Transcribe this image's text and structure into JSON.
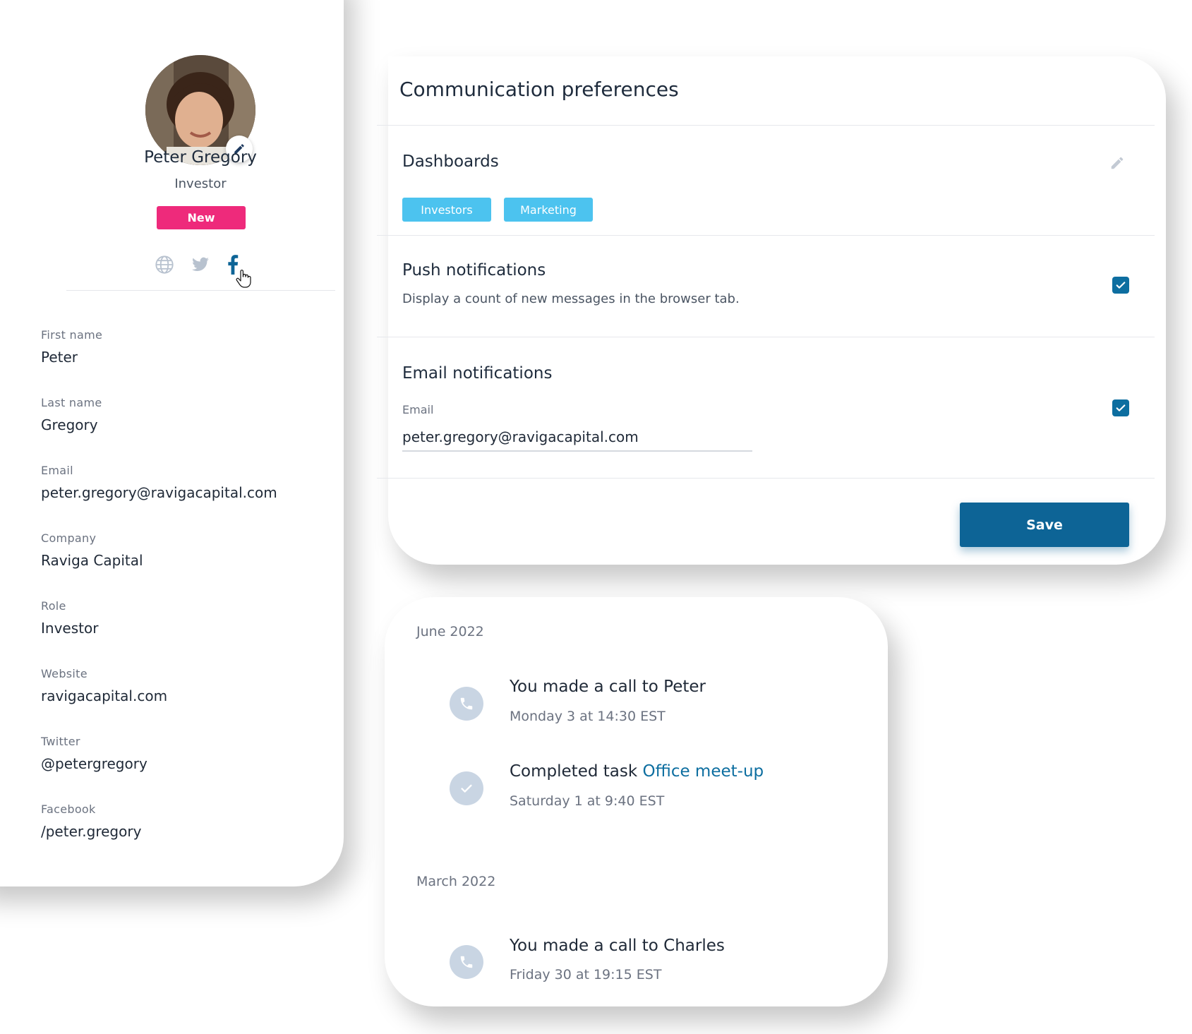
{
  "profile": {
    "name": "Peter Gregory",
    "role": "Investor",
    "badge": "New",
    "fields": [
      {
        "label": "First name",
        "value": "Peter"
      },
      {
        "label": "Last name",
        "value": "Gregory"
      },
      {
        "label": "Email",
        "value": "peter.gregory@ravigacapital.com"
      },
      {
        "label": "Company",
        "value": "Raviga Capital"
      },
      {
        "label": "Role",
        "value": "Investor"
      },
      {
        "label": "Website",
        "value": "ravigacapital.com"
      },
      {
        "label": "Twitter",
        "value": "@petergregory"
      },
      {
        "label": "Facebook",
        "value": "/peter.gregory"
      }
    ],
    "social_icons": [
      "globe-icon",
      "twitter-icon",
      "facebook-icon"
    ]
  },
  "preferences": {
    "title": "Communication preferences",
    "dashboards": {
      "title": "Dashboards",
      "tags": [
        "Investors",
        "Marketing"
      ]
    },
    "push": {
      "title": "Push notifications",
      "description": "Display a count of new messages in the browser tab.",
      "checked": true
    },
    "email": {
      "title": "Email notifications",
      "field_label": "Email",
      "field_value": "peter.gregory@ravigacapital.com",
      "checked": true
    },
    "save_label": "Save"
  },
  "activity": {
    "groups": [
      {
        "month": "June 2022",
        "items": [
          {
            "icon": "phone-icon",
            "title": "You made a call to Peter",
            "time": "Monday 3 at 14:30 EST"
          },
          {
            "icon": "check-icon",
            "title_prefix": "Completed task ",
            "link": "Office meet-up",
            "time": "Saturday 1 at 9:40 EST"
          }
        ]
      },
      {
        "month": "March 2022",
        "items": [
          {
            "icon": "phone-icon",
            "title": "You made a call to Charles",
            "time": "Friday 30 at 19:15 EST"
          }
        ]
      }
    ]
  },
  "colors": {
    "primary": "#0d6496",
    "badge_new": "#ee2a7b",
    "tag": "#4cc3ef",
    "link": "#0d6ea0",
    "activity_icon_bg": "#c9d5e3"
  }
}
